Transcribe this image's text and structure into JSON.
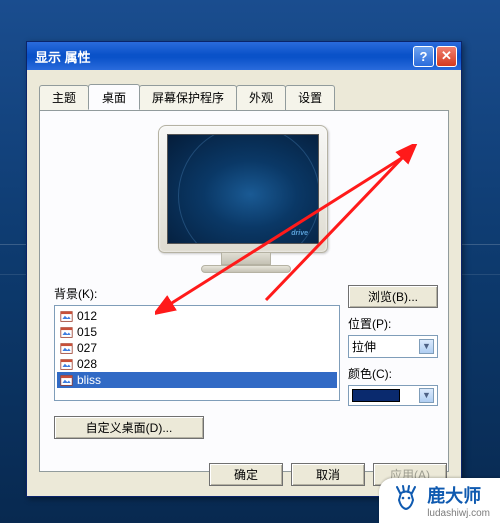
{
  "titlebar": {
    "title": "显示 属性"
  },
  "tabs": [
    {
      "label": "主题"
    },
    {
      "label": "桌面"
    },
    {
      "label": "屏幕保护程序"
    },
    {
      "label": "外观"
    },
    {
      "label": "设置"
    }
  ],
  "activeTabIndex": 1,
  "monitor": {
    "brand": "drive"
  },
  "background": {
    "label": "背景(K):",
    "items": [
      {
        "name": "012",
        "icon": "image-file-icon"
      },
      {
        "name": "015",
        "icon": "image-file-icon"
      },
      {
        "name": "027",
        "icon": "image-file-icon"
      },
      {
        "name": "028",
        "icon": "image-file-icon"
      },
      {
        "name": "bliss",
        "icon": "image-file-icon"
      }
    ],
    "selectedIndex": 4,
    "browse": "浏览(B)...",
    "positionLabel": "位置(P):",
    "positionValue": "拉伸",
    "colorLabel": "颜色(C):",
    "colorValue": "#0a2a6e"
  },
  "customDesktop": "自定义桌面(D)...",
  "buttons": {
    "ok": "确定",
    "cancel": "取消",
    "apply": "应用(A)"
  },
  "watermark": {
    "title": "鹿大师",
    "sub": "ludashiwj.com"
  }
}
